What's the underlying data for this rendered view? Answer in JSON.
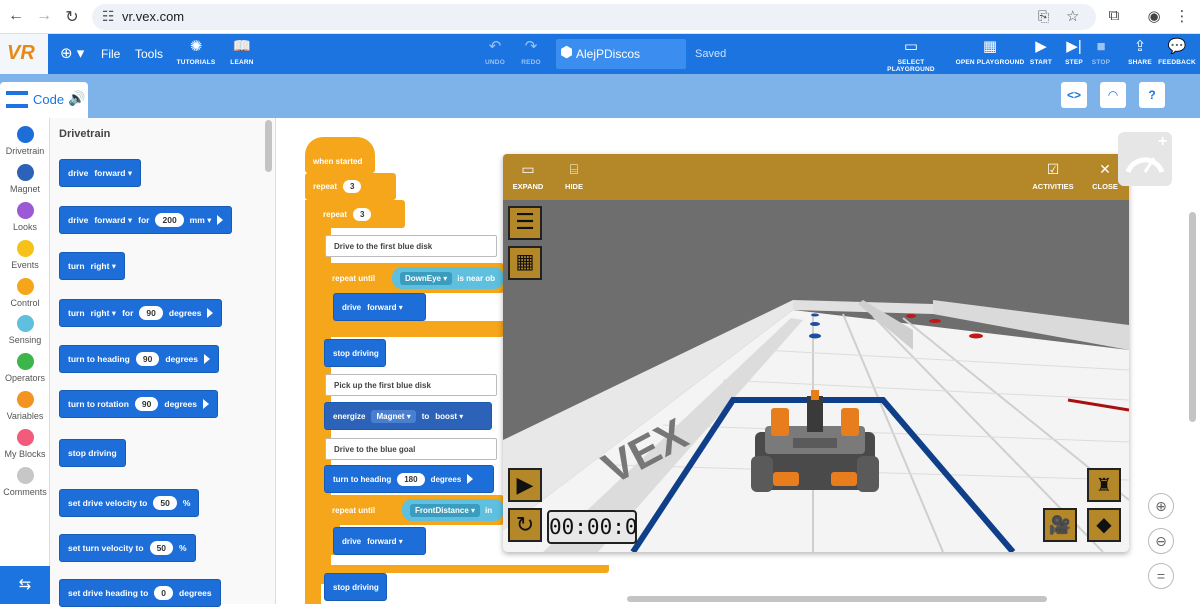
{
  "browser": {
    "url": "vr.vex.com"
  },
  "header": {
    "logo": "VR",
    "menu": [
      "File",
      "Tools"
    ],
    "tutorials": "TUTORIALS",
    "learn": "LEARN",
    "undo": "UNDO",
    "redo": "REDO",
    "project_name": "AlejPDiscos",
    "status": "Saved",
    "select_playground": "SELECT PLAYGROUND",
    "open_playground": "OPEN PLAYGROUND",
    "start": "START",
    "step": "STEP",
    "stop": "STOP",
    "share": "SHARE",
    "feedback": "FEEDBACK"
  },
  "toolbar": {
    "code_tab": "Code"
  },
  "categories": [
    {
      "label": "Drivetrain",
      "color": "#1d6ed8"
    },
    {
      "label": "Magnet",
      "color": "#2c63b8"
    },
    {
      "label": "Looks",
      "color": "#9b59d6"
    },
    {
      "label": "Events",
      "color": "#f6c21a"
    },
    {
      "label": "Control",
      "color": "#f6a61a"
    },
    {
      "label": "Sensing",
      "color": "#5ec0de"
    },
    {
      "label": "Operators",
      "color": "#3cb54a"
    },
    {
      "label": "Variables",
      "color": "#f39322"
    },
    {
      "label": "My Blocks",
      "color": "#f25b7a"
    },
    {
      "label": "Comments",
      "color": "#c7c7c7"
    }
  ],
  "palette": {
    "title": "Drivetrain",
    "blocks": {
      "b1": {
        "t1": "drive",
        "d1": "forward"
      },
      "b2": {
        "t1": "drive",
        "d1": "forward",
        "t2": "for",
        "v1": "200",
        "d2": "mm"
      },
      "b3": {
        "t1": "turn",
        "d1": "right"
      },
      "b4": {
        "t1": "turn",
        "d1": "right",
        "t2": "for",
        "v1": "90",
        "t3": "degrees"
      },
      "b5": {
        "t1": "turn to heading",
        "v1": "90",
        "t2": "degrees"
      },
      "b6": {
        "t1": "turn to rotation",
        "v1": "90",
        "t2": "degrees"
      },
      "b7": {
        "t1": "stop driving"
      },
      "b8": {
        "t1": "set drive velocity to",
        "v1": "50",
        "t2": "%"
      },
      "b9": {
        "t1": "set turn velocity to",
        "v1": "50",
        "t2": "%"
      },
      "b10": {
        "t1": "set drive heading to",
        "v1": "0",
        "t2": "degrees"
      }
    }
  },
  "script": {
    "when_started": "when started",
    "repeat_label": "repeat",
    "repeat1_count": "3",
    "repeat2_count": "3",
    "comment1": "Drive to the first blue disk",
    "repeat_until": "repeat until",
    "sensor1": "DownEye",
    "sensor1_cond": "is near ob",
    "drive1": {
      "t1": "drive",
      "d1": "forward"
    },
    "stop1": "stop driving",
    "comment2": "Pick up the first blue disk",
    "energize": {
      "t1": "energize",
      "d1": "Magnet",
      "t2": "to",
      "d2": "boost"
    },
    "comment3": "Drive to the blue goal",
    "heading": {
      "t1": "turn to heading",
      "v1": "180",
      "t2": "degrees"
    },
    "repeat_until2": "repeat until",
    "sensor2": "FrontDistance",
    "sensor2_cond": "in",
    "drive2": {
      "t1": "drive",
      "d1": "forward"
    },
    "stop2": "stop driving"
  },
  "playground": {
    "expand": "EXPAND",
    "hide": "HIDE",
    "activities": "ACTIVITIES",
    "close": "CLOSE",
    "timer": "00:00:0",
    "wall_text": "VEX"
  }
}
